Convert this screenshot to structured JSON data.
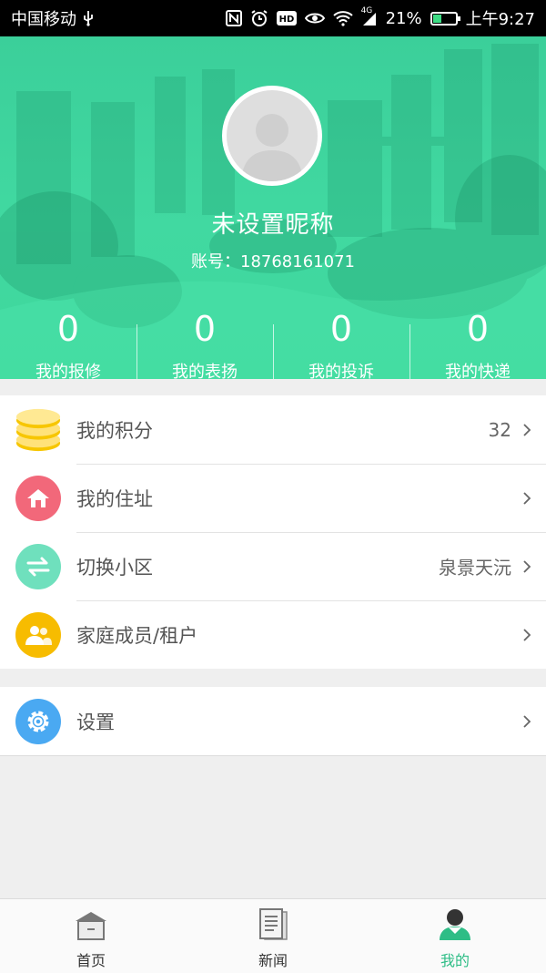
{
  "status_bar": {
    "carrier": "中国移动",
    "network": "4G",
    "battery": "21%",
    "battery_level": 0.21,
    "time": "上午9:27"
  },
  "profile": {
    "nickname": "未设置昵称",
    "account": "账号：18768161071"
  },
  "stats": [
    {
      "value": "0",
      "label": "我的报修"
    },
    {
      "value": "0",
      "label": "我的表扬"
    },
    {
      "value": "0",
      "label": "我的投诉"
    },
    {
      "value": "0",
      "label": "我的快递"
    }
  ],
  "menu": [
    {
      "title": "我的积分",
      "value": "32",
      "icon": "coins-icon",
      "color": "#ffe07a"
    },
    {
      "title": "我的住址",
      "value": "",
      "icon": "home-icon",
      "color": "#f2687a"
    },
    {
      "title": "切换小区",
      "value": "泉景天沅",
      "icon": "switch-icon",
      "color": "#6fe0bd"
    },
    {
      "title": "家庭成员/租户",
      "value": "",
      "icon": "family-icon",
      "color": "#f7bc00"
    }
  ],
  "settings": {
    "title": "设置",
    "icon": "gear-icon",
    "color": "#4aa9f2"
  },
  "tabs": [
    {
      "label": "首页",
      "icon": "house-icon"
    },
    {
      "label": "新闻",
      "icon": "news-icon"
    },
    {
      "label": "我的",
      "icon": "person-icon",
      "active": true
    }
  ],
  "colors": {
    "accent": "#2ebd86"
  }
}
